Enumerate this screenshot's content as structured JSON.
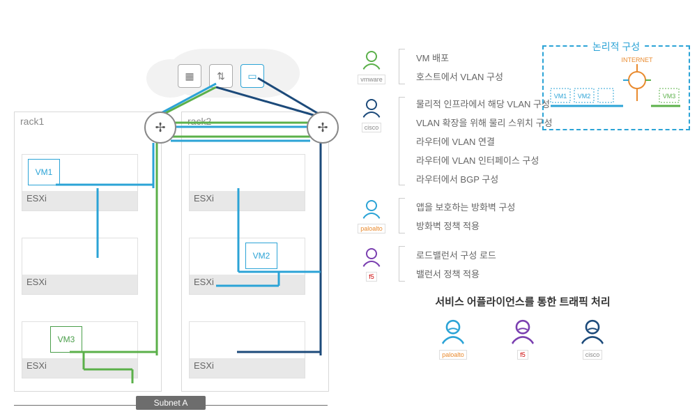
{
  "left": {
    "rack1": "rack1",
    "rack2": "rack2",
    "esxi": "ESXi",
    "vm1": "VM1",
    "vm2": "VM2",
    "vm3": "VM3",
    "subnet": "Subnet A"
  },
  "logical": {
    "title": "논리적 구성",
    "internet": "INTERNET",
    "vm1": "VM1",
    "vm2": "VM2",
    "vm3": "VM3"
  },
  "roles": {
    "vmware": {
      "brand": "vmware",
      "items": [
        "VM 배포",
        "호스트에서 VLAN 구성"
      ]
    },
    "cisco": {
      "brand": "cisco",
      "items": [
        "물리적 인프라에서 해당 VLAN 구성",
        "VLAN 확장을 위해 물리 스위치 구성",
        "라우터에 VLAN 연결",
        "라우터에 VLAN 인터페이스 구성",
        "라우터에서 BGP 구성"
      ]
    },
    "palo": {
      "brand": "paloalto",
      "items": [
        "앱을 보호하는 방화벽 구성",
        "방화벽 정책 적용"
      ]
    },
    "f5": {
      "brand": "f5",
      "items": [
        "로드밸런서 구성 로드",
        "밸런서 정책 적용"
      ]
    }
  },
  "traffic_title": "서비스 어플라이언스를 통한 트래픽 처리",
  "bottom_brands": [
    "paloalto",
    "f5",
    "cisco"
  ],
  "colors": {
    "blue": "#2ba3d6",
    "green": "#5bb04a",
    "navy": "#1c4a7a",
    "purple": "#7a3fb0",
    "orange": "#e98a2e"
  }
}
